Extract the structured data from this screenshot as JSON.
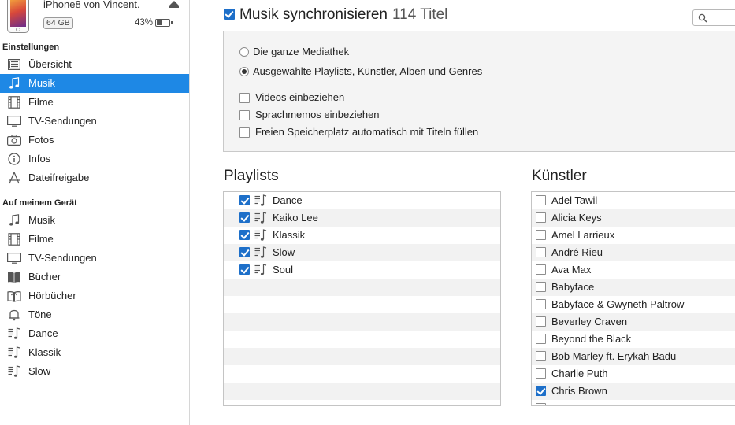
{
  "device": {
    "name": "iPhone8 von Vincent.",
    "capacity": "64 GB",
    "battery_text": "43%",
    "battery_level": 0.43
  },
  "sidebar": {
    "settings_heading": "Einstellungen",
    "settings_items": [
      {
        "label": "Übersicht",
        "icon": "summary-icon"
      },
      {
        "label": "Musik",
        "icon": "music-note-icon",
        "active": true
      },
      {
        "label": "Filme",
        "icon": "film-icon"
      },
      {
        "label": "TV-Sendungen",
        "icon": "tv-icon"
      },
      {
        "label": "Fotos",
        "icon": "camera-icon"
      },
      {
        "label": "Infos",
        "icon": "info-icon"
      },
      {
        "label": "Dateifreigabe",
        "icon": "apps-icon"
      }
    ],
    "device_heading": "Auf meinem Gerät",
    "device_items": [
      {
        "label": "Musik",
        "icon": "music-note-icon"
      },
      {
        "label": "Filme",
        "icon": "film-icon"
      },
      {
        "label": "TV-Sendungen",
        "icon": "tv-icon"
      },
      {
        "label": "Bücher",
        "icon": "book-icon"
      },
      {
        "label": "Hörbücher",
        "icon": "audiobook-icon"
      },
      {
        "label": "Töne",
        "icon": "bell-icon"
      },
      {
        "label": "Dance",
        "icon": "playlist-icon"
      },
      {
        "label": "Klassik",
        "icon": "playlist-icon"
      },
      {
        "label": "Slow",
        "icon": "playlist-icon"
      }
    ]
  },
  "main": {
    "sync_label": "Musik synchronisieren",
    "sync_count": "114 Titel",
    "sync_checked": true,
    "options": {
      "radio_all": "Die ganze Mediathek",
      "radio_selected": "Ausgewählte Playlists, Künstler, Alben und Genres",
      "include_videos": "Videos einbeziehen",
      "include_voice_memos": "Sprachmemos einbeziehen",
      "autofill": "Freien Speicherplatz automatisch mit Titeln füllen"
    },
    "playlists_title": "Playlists",
    "playlists": [
      {
        "name": "Dance",
        "checked": true
      },
      {
        "name": "Kaiko Lee",
        "checked": true
      },
      {
        "name": "Klassik",
        "checked": true
      },
      {
        "name": "Slow",
        "checked": true
      },
      {
        "name": "Soul",
        "checked": true
      }
    ],
    "playlist_empty_rows": 7,
    "artists_title": "Künstler",
    "artists": [
      {
        "name": "Adel Tawil",
        "checked": false
      },
      {
        "name": "Alicia Keys",
        "checked": false
      },
      {
        "name": "Amel Larrieux",
        "checked": false
      },
      {
        "name": "André Rieu",
        "checked": false
      },
      {
        "name": "Ava Max",
        "checked": false
      },
      {
        "name": "Babyface",
        "checked": false
      },
      {
        "name": "Babyface & Gwyneth Paltrow",
        "checked": false
      },
      {
        "name": "Beverley Craven",
        "checked": false
      },
      {
        "name": "Beyond the Black",
        "checked": false
      },
      {
        "name": "Bob Marley ft. Erykah Badu",
        "checked": false
      },
      {
        "name": "Charlie Puth",
        "checked": false
      },
      {
        "name": "Chris Brown",
        "checked": true
      },
      {
        "name": "",
        "checked": false
      }
    ]
  },
  "colors": {
    "accent": "#1e88e5",
    "checkbox": "#1d6fc9"
  }
}
